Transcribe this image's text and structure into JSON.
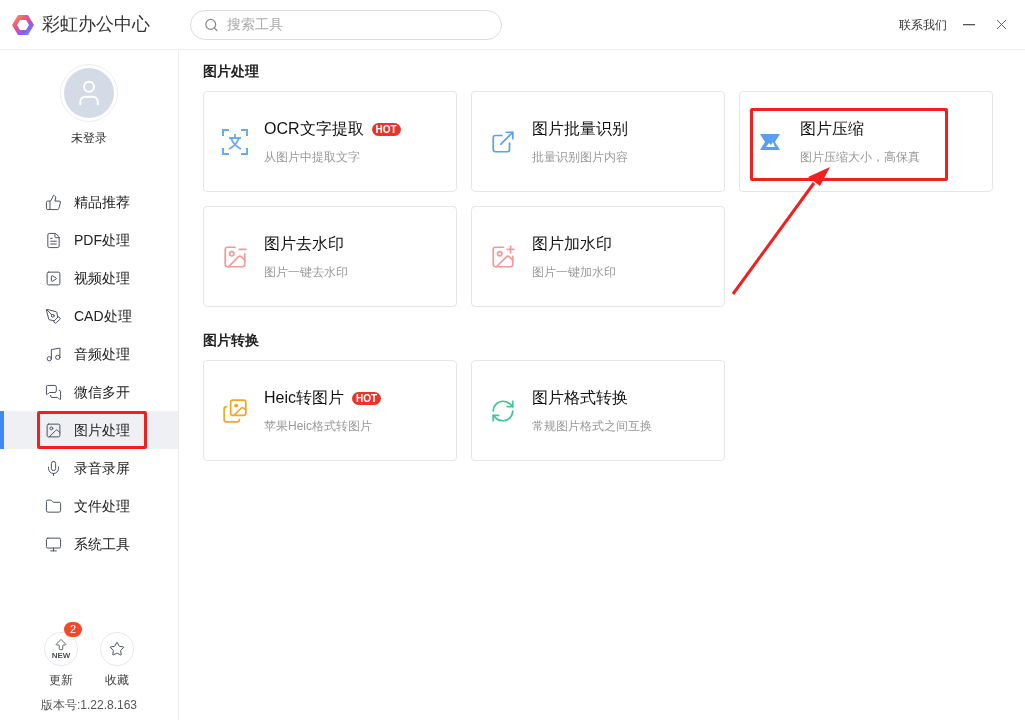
{
  "app": {
    "title": "彩虹办公中心"
  },
  "search": {
    "placeholder": "搜索工具"
  },
  "header": {
    "contact": "联系我们"
  },
  "user": {
    "status": "未登录"
  },
  "sidebar": {
    "items": [
      {
        "label": "精品推荐",
        "selected": false,
        "highlighted": false
      },
      {
        "label": "PDF处理",
        "selected": false,
        "highlighted": false
      },
      {
        "label": "视频处理",
        "selected": false,
        "highlighted": false
      },
      {
        "label": "CAD处理",
        "selected": false,
        "highlighted": false
      },
      {
        "label": "音频处理",
        "selected": false,
        "highlighted": false
      },
      {
        "label": "微信多开",
        "selected": false,
        "highlighted": false
      },
      {
        "label": "图片处理",
        "selected": true,
        "highlighted": true
      },
      {
        "label": "录音录屏",
        "selected": false,
        "highlighted": false
      },
      {
        "label": "文件处理",
        "selected": false,
        "highlighted": false
      },
      {
        "label": "系统工具",
        "selected": false,
        "highlighted": false
      }
    ]
  },
  "sections": [
    {
      "title": "图片处理",
      "tools": [
        {
          "title": "OCR文字提取",
          "subtitle": "从图片中提取文字",
          "badge": "HOT",
          "highlighted": false
        },
        {
          "title": "图片批量识别",
          "subtitle": "批量识别图片内容",
          "highlighted": false
        },
        {
          "title": "图片压缩",
          "subtitle": "图片压缩大小，高保真",
          "highlighted": true
        },
        {
          "title": "图片去水印",
          "subtitle": "图片一键去水印",
          "highlighted": false
        },
        {
          "title": "图片加水印",
          "subtitle": "图片一键加水印",
          "highlighted": false
        }
      ]
    },
    {
      "title": "图片转换",
      "tools": [
        {
          "title": "Heic转图片",
          "subtitle": "苹果Heic格式转图片",
          "badge": "HOT",
          "highlighted": false
        },
        {
          "title": "图片格式转换",
          "subtitle": "常规图片格式之间互换",
          "highlighted": false
        }
      ]
    }
  ],
  "footer": {
    "buttons": [
      {
        "label": "更新",
        "icon_text": "NEW",
        "badge": "2"
      },
      {
        "label": "收藏"
      }
    ],
    "version": "版本号:1.22.8.163"
  },
  "annotation": {
    "arrow": true
  }
}
